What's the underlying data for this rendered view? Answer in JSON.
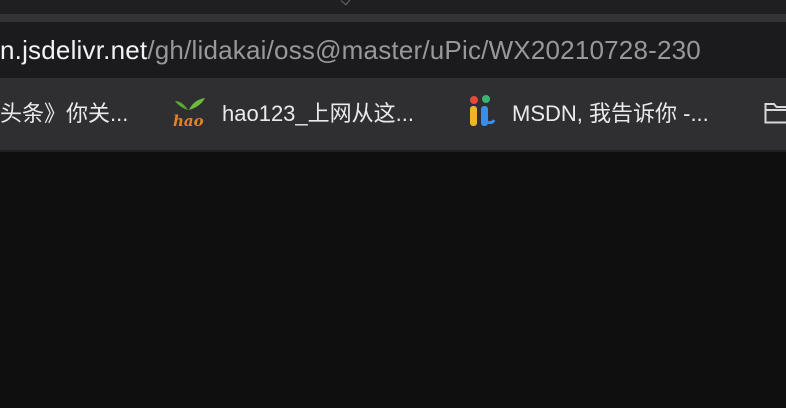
{
  "url": {
    "host_fragment": "n.jsdelivr.net",
    "path_fragment": "/gh/lidakai/oss@master/uPic/WX20210728-230"
  },
  "bookmarks": [
    {
      "label": "头条》你关...",
      "icon": "none"
    },
    {
      "label": "hao123_上网从这...",
      "icon": "hao123-logo-icon"
    },
    {
      "label": "MSDN, 我告诉你 -...",
      "icon": "msdn-itellyou-icon"
    },
    {
      "label": "",
      "icon": "folder-icon"
    }
  ],
  "colors": {
    "url_host": "#f2f2f4",
    "url_path": "#98989c",
    "bookmark_bar_bg": "#2f2f32",
    "url_bar_bg": "#1b1b1d",
    "page_bg": "#0f0f10"
  }
}
